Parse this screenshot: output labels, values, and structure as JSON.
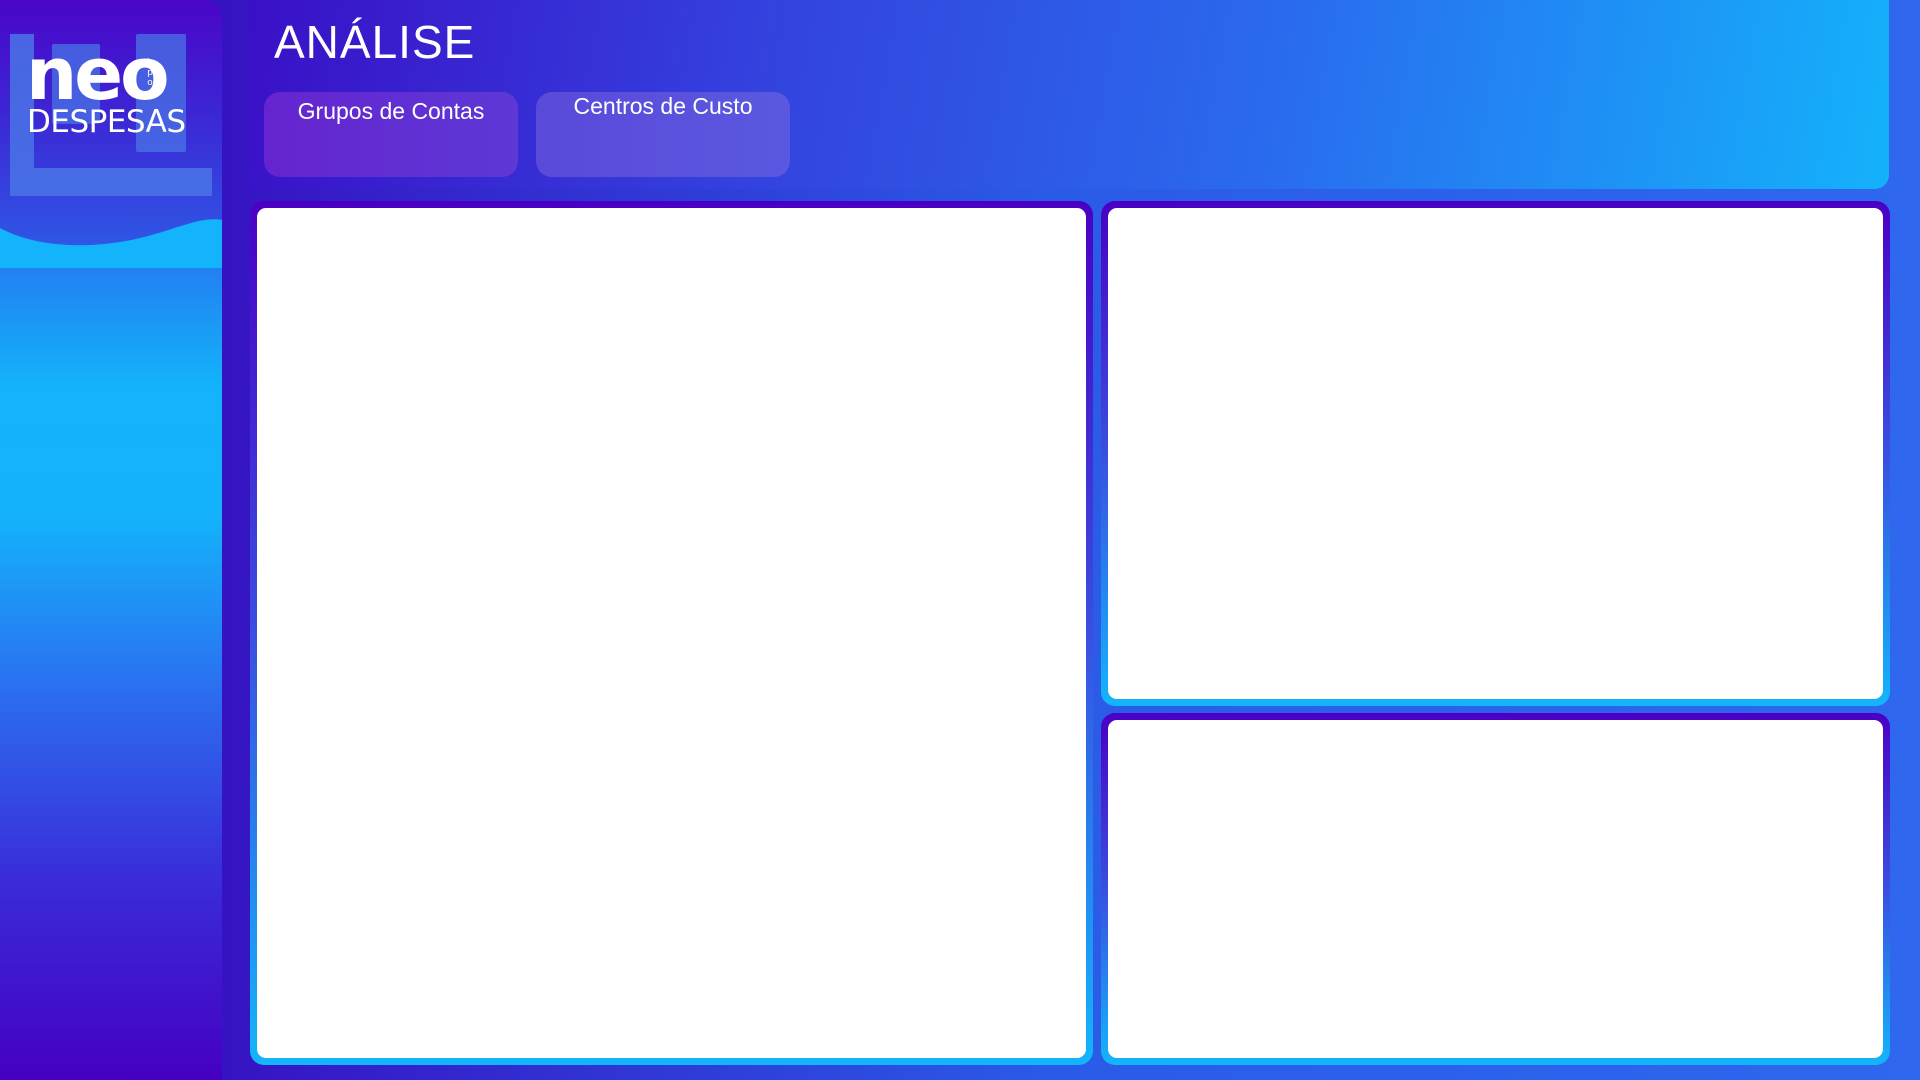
{
  "sidebar": {
    "logo": {
      "brand": "neo",
      "sub": "bpo",
      "product": "DESPESAS"
    }
  },
  "header": {
    "title": "ANÁLISE",
    "tabs": [
      {
        "label": "Grupos de Contas"
      },
      {
        "label": "Centros de Custo"
      }
    ]
  },
  "colors": {
    "background_dark": "#3a00b8",
    "accent_blue": "#2a6aee",
    "accent_cyan": "#13b5fb",
    "panel_fill": "#ffffff"
  }
}
